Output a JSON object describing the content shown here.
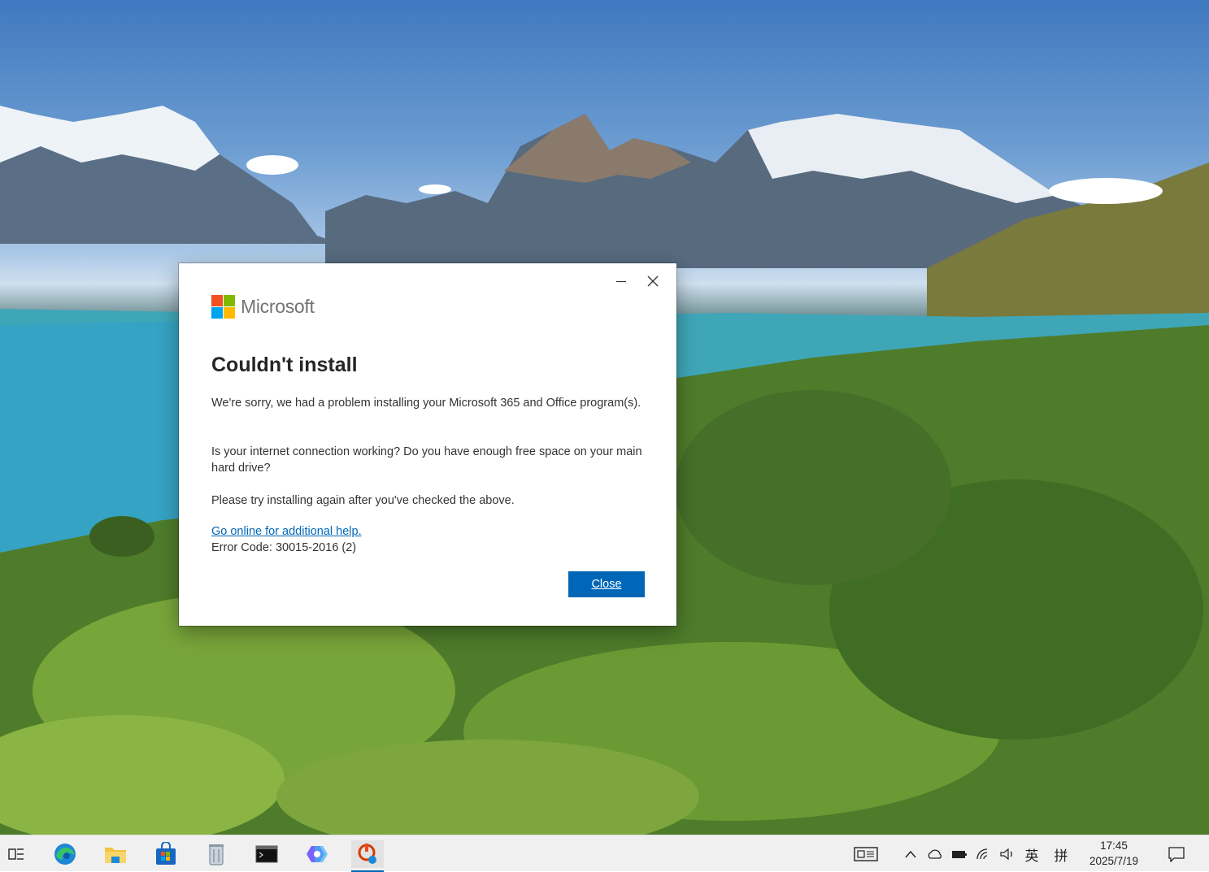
{
  "dialog": {
    "brand": "Microsoft",
    "title": "Couldn't install",
    "message1": "We're sorry, we had a problem installing your Microsoft 365 and Office program(s).",
    "message2": "Is your internet connection working?  Do you have enough free space on your main hard drive?",
    "message3": "Please try installing again after you've checked the above.",
    "help_link": "Go online for additional help.",
    "error_code": "Error Code: 30015-2016 (2)",
    "close_label": "Close",
    "accent_color": "#0067b8"
  },
  "taskbar": {
    "apps": [
      "task-view",
      "edge",
      "file-explorer",
      "microsoft-store",
      "recycle-bin",
      "command-prompt",
      "copilot",
      "office-setup"
    ],
    "tray": {
      "ime_lang": "英",
      "ime_mode": "拼"
    },
    "clock": {
      "time": "17:45",
      "date": "2025/7/19"
    }
  }
}
